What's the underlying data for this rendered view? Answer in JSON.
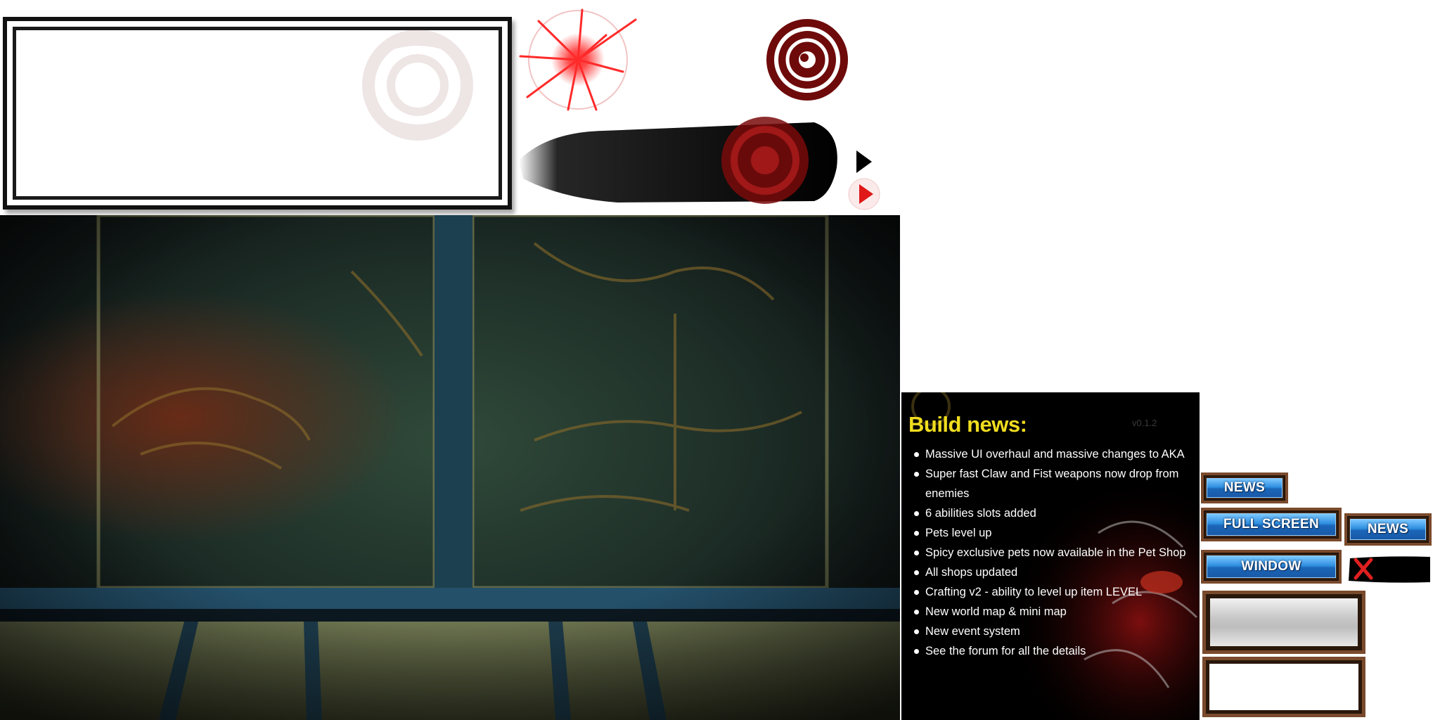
{
  "news": {
    "title": "Build news:",
    "version": "v0.1.2",
    "items": [
      "Massive UI overhaul and massive changes to AKA",
      "Super fast Claw and Fist weapons now drop from enemies",
      "6 abilities slots added",
      "Pets level up",
      "Spicy exclusive pets now available in the Pet Shop",
      "All shops updated",
      "Crafting v2 - ability to level up item LEVEL",
      "New world map & mini map",
      "New event system",
      "See the forum for all the details"
    ]
  },
  "buttons": {
    "news_1": "NEWS",
    "full_screen": "FULL SCREEN",
    "news_2": "NEWS",
    "window": "WINDOW"
  },
  "icons": {
    "burst": "red-burst-icon",
    "seal": "red-seal-icon",
    "arrow_black": "play-arrow-icon",
    "arrow_red": "play-arrow-red-icon",
    "close": "close-x-icon"
  },
  "colors": {
    "news_title": "#f0dd1e",
    "button_blue": "#2f8fe0",
    "frame_wood": "#7a4a2c",
    "seal_red": "#7a0a0a"
  }
}
